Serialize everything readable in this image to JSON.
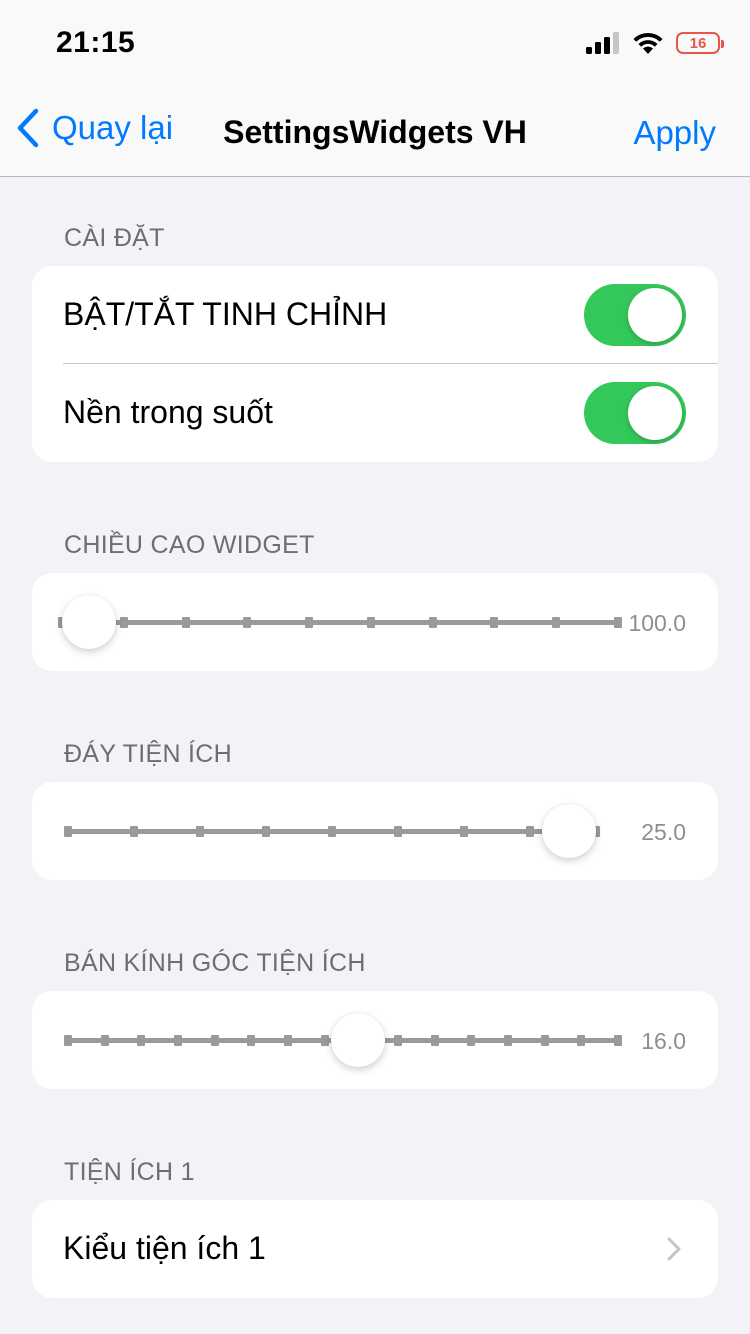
{
  "status_bar": {
    "time": "21:15",
    "battery": "16",
    "battery_color": "#e5574a"
  },
  "nav": {
    "back_label": "Quay lại",
    "title": "SettingsWidgets VH",
    "apply_label": "Apply",
    "accent_color": "#007aff"
  },
  "sections": {
    "settings": {
      "header": "CÀI ĐẶT",
      "toggles": [
        {
          "label": "BẬT/TẮT TINH CHỈNH",
          "on": true
        },
        {
          "label": "Nền trong suốt",
          "on": true
        }
      ],
      "toggle_color": "#34c759"
    },
    "widget_height": {
      "header": "CHIỀU CAO WIDGET",
      "value_label": "100.0",
      "position_fraction": 0.0,
      "tick_count": 10
    },
    "widget_bottom": {
      "header": "ĐÁY TIỆN ÍCH",
      "value_label": "25.0",
      "position_fraction": 1.0,
      "tick_count": 9
    },
    "corner_radius": {
      "header": "BÁN KÍNH GÓC TIỆN ÍCH",
      "value_label": "16.0",
      "position_fraction": 0.53,
      "tick_count": 16
    },
    "widget1": {
      "header": "TIỆN ÍCH  1",
      "row_label": "Kiểu tiện ích 1"
    }
  }
}
